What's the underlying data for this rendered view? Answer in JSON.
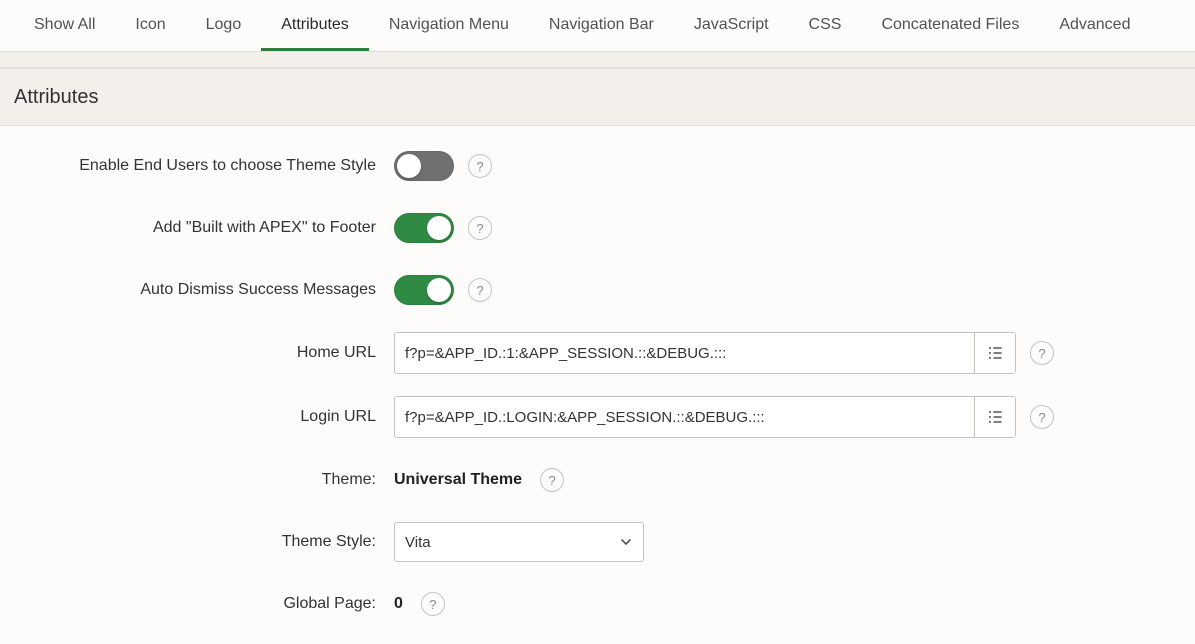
{
  "tabs": {
    "show_all": "Show All",
    "icon": "Icon",
    "logo": "Logo",
    "attributes": "Attributes",
    "nav_menu": "Navigation Menu",
    "nav_bar": "Navigation Bar",
    "javascript": "JavaScript",
    "css": "CSS",
    "concat_files": "Concatenated Files",
    "advanced": "Advanced",
    "active": "attributes"
  },
  "section": {
    "title": "Attributes"
  },
  "form": {
    "enable_theme_style": {
      "label": "Enable End Users to choose Theme Style",
      "on": false
    },
    "built_with_apex": {
      "label": "Add \"Built with APEX\" to Footer",
      "on": true
    },
    "auto_dismiss": {
      "label": "Auto Dismiss Success Messages",
      "on": true
    },
    "home_url": {
      "label": "Home URL",
      "value": "f?p=&APP_ID.:1:&APP_SESSION.::&DEBUG.:::"
    },
    "login_url": {
      "label": "Login URL",
      "value": "f?p=&APP_ID.:LOGIN:&APP_SESSION.::&DEBUG.:::"
    },
    "theme": {
      "label": "Theme:",
      "value": "Universal Theme"
    },
    "theme_style": {
      "label": "Theme Style:",
      "value": "Vita"
    },
    "global_page": {
      "label": "Global Page:",
      "value": "0"
    }
  },
  "glyphs": {
    "help": "?"
  }
}
